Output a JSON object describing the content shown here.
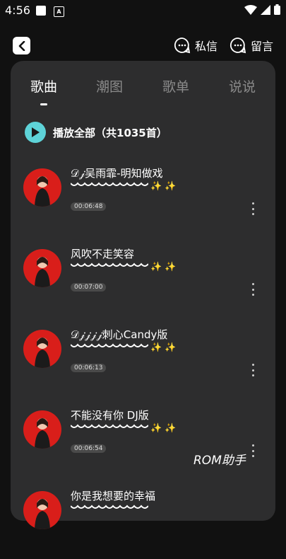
{
  "status_bar": {
    "time": "4:56",
    "a_icon_letter": "A"
  },
  "header": {
    "messages_label": "私信",
    "comments_label": "留言"
  },
  "tabs": [
    {
      "label": "歌曲",
      "active": true
    },
    {
      "label": "潮图",
      "active": false
    },
    {
      "label": "歌单",
      "active": false
    },
    {
      "label": "说说",
      "active": false
    }
  ],
  "play_all_label": "播放全部（共1035首）",
  "songs": [
    {
      "title": "𝒟𝒿吴雨霏-明知做戏",
      "duration": "00:06:48"
    },
    {
      "title": "风吹不走笑容",
      "duration": "00:07:00"
    },
    {
      "title": "𝒟𝒿𝒿𝒿𝒿刺心Candy版",
      "duration": "00:06:13"
    },
    {
      "title": "不能没有你 DJ版",
      "duration": "00:06:54"
    },
    {
      "title": "你是我想要的幸福",
      "duration": ""
    }
  ],
  "sparkles": "✨✨",
  "watermark": "ROM助手",
  "colors": {
    "play_button": "#5ed3d8",
    "card_bg": "#2d2d2e",
    "avatar_bg": "#d91e1a",
    "sparkle": "#f5d23a"
  }
}
